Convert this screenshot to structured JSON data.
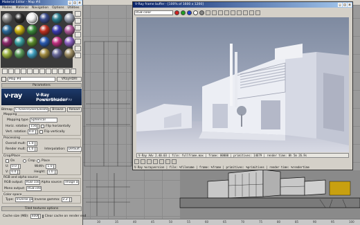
{
  "material_editor": {
    "title": "Material Editor - Map #4",
    "menu": [
      "Modes",
      "Material",
      "Navigation",
      "Options",
      "Utilities"
    ],
    "sphere_colors": [
      "#8a8a8a",
      "#2a2a2a",
      "#f2f2f2",
      "#3a4a8a",
      "#2a7a8a",
      "#9aa0b0",
      "#2a6a9a",
      "#c8b010",
      "#3a8a3a",
      "#c03020",
      "#3a3ab0",
      "#b05a9a",
      "#8a2a6a",
      "#3aa0a0",
      "#5a8a2a",
      "#2a5ab0",
      "#c03080",
      "#8a60c0",
      "#9ab040",
      "#5a9a5a",
      "#40a0c0",
      "#a08a40",
      "#6a6a9a",
      "#9a8a60"
    ],
    "map_name": "Map #4",
    "map_type": "VRayHDRI",
    "parameters_header": "Parameters",
    "banner": {
      "logo": "v·ray",
      "title": "V-Ray PowerShader",
      "subtitle": "optimized for V-Ray"
    },
    "bitmap_label": "Bitmap",
    "bitmap_path": "C:\\Users\\User\\Desktop\\Environment",
    "browse": "Browse",
    "reload": "Reload",
    "mapping_label": "Mapping",
    "mapping_type_label": "Mapping type",
    "mapping_type_value": "Spherical",
    "horiz_rotation_label": "Horiz. rotation",
    "horiz_rotation_value": "156.0",
    "flip_horizontally": "Flip horizontally",
    "vert_rotation_label": "Vert. rotation",
    "vert_rotation_value": "0.0",
    "flip_vertically": "Flip vertically",
    "processing_label": "Processing",
    "overall_mult_label": "Overall mult:",
    "overall_mult_value": "1.0",
    "render_mult_label": "Render mult:",
    "render_mult_value": "1.0",
    "interpolation_label": "Interpolation:",
    "interpolation_value": "Default",
    "crop_label": "Crop/Place",
    "crop_on": "On",
    "crop": "Crop",
    "place": "Place",
    "u_label": "U:",
    "u_value": "0.0",
    "v_label": "V:",
    "v_value": "0.0",
    "w_label": "Width:",
    "w_value": "1.0",
    "h_label": "Height:",
    "h_value": "1.0",
    "rgb_alpha_label": "RGB and alpha source",
    "rgb_output_label": "RGB output:",
    "rgb_output_value": "RGB color",
    "alpha_source_label": "Alpha source:",
    "alpha_source_value": "Image alpha",
    "mono_output_label": "Mono output:",
    "mono_output_value": "RGB intensity",
    "color_space_label": "Color space",
    "type_label": "Type:",
    "type_value": "Inverse gamma",
    "inverse_gamma_label": "Inverse gamma:",
    "inverse_gamma_value": "2.2",
    "tiled_header": "Tiled textures options",
    "cache_size_label": "Cache size (MB):",
    "cache_size_value": "4000",
    "clear_cache": "Clear cache on render end"
  },
  "vfb": {
    "title": "V-Ray frame buffer - [100% of 1600 x 1200]",
    "channel": "RGB color",
    "render_info": "V-Ray Adv 2.40.03 | file: fullframe.max | frame: 00000 | primitives: 14679 | render time: 0h 5m 26.9s",
    "status": "V-Ray %vrayversion | file: %filename | frame: %frame | primitives: %primitives | render time: %rendertime"
  },
  "ruler": {
    "ticks": [
      "30",
      "35",
      "40",
      "45",
      "50",
      "55",
      "60",
      "65",
      "70",
      "75",
      "80",
      "85",
      "90",
      "95",
      "100"
    ]
  }
}
